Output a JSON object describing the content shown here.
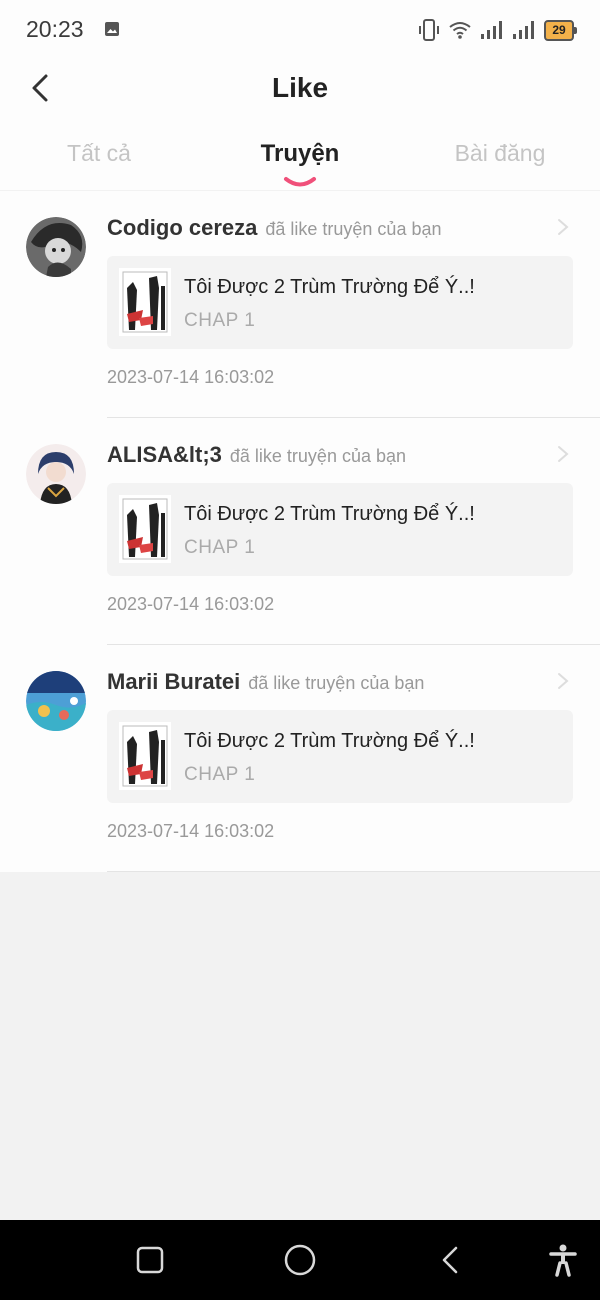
{
  "status_bar": {
    "time": "20:23",
    "battery": "29",
    "icons": [
      "image-notification-icon",
      "vibrate-icon",
      "wifi-icon",
      "signal-icon",
      "signal-icon",
      "battery-icon"
    ]
  },
  "header": {
    "title": "Like",
    "back_icon": "chevron-left-icon"
  },
  "tabs": [
    {
      "label": "Tất cả",
      "active": false
    },
    {
      "label": "Truyện",
      "active": true
    },
    {
      "label": "Bài đăng",
      "active": false
    }
  ],
  "accent_color": "#f0507a",
  "items": [
    {
      "username": "Codigo cereza",
      "action": "đã like truyện của bạn",
      "manga_title": "Tôi Được 2 Trùm Trường Để Ý..!",
      "chapter": "CHAP 1",
      "timestamp": "2023-07-14 16:03:02"
    },
    {
      "username": "ALISA&lt;3",
      "action": "đã like truyện của bạn",
      "manga_title": "Tôi Được 2 Trùm Trường Để Ý..!",
      "chapter": "CHAP 1",
      "timestamp": "2023-07-14 16:03:02"
    },
    {
      "username": "Marii Buratei",
      "action": "đã like truyện của bạn",
      "manga_title": "Tôi Được 2 Trùm Trường Để Ý..!",
      "chapter": "CHAP 1",
      "timestamp": "2023-07-14 16:03:02"
    }
  ],
  "nav_bar": {
    "buttons": [
      "recents-square-icon",
      "home-circle-icon",
      "back-triangle-icon",
      "accessibility-icon"
    ]
  }
}
